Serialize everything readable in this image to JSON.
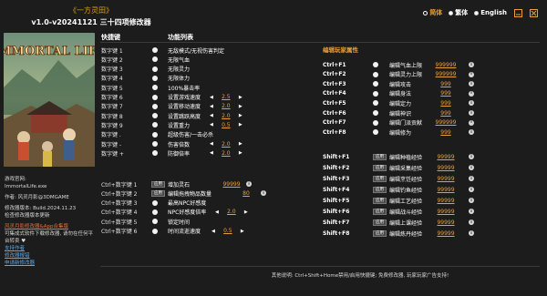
{
  "header": {
    "game_name": "《一方灵田》",
    "app_version": "v1.0-v20241121 三十四项修改器"
  },
  "language": [
    {
      "label": "简体",
      "selected": true
    },
    {
      "label": "繁体",
      "selected": false
    },
    {
      "label": "English",
      "selected": false
    }
  ],
  "colors": {
    "accent": "#e8a038",
    "background": "#1c1c1c",
    "link": "#5aa8e8",
    "title": "#d4a017"
  },
  "cover": {
    "logo_text": "IMMORTAL LIFE"
  },
  "left_info": {
    "site_label": "游戏官网:",
    "site_value": "ImmortalLife.exe",
    "author": "作者: 风灵月影@3DMGAME",
    "version": "修改器版本: Build.2024.11.23",
    "check_update": "检查修改器版本更新",
    "app_promo": "风灵月影修改器&App合集版",
    "app_desc": "可集成式软件下载修改器, 请勿在任何平台转卖 ♥",
    "support": "支持作者",
    "report": "修改器报错",
    "request": "申请新修改器"
  },
  "columns": {
    "hotkey": "快捷键",
    "function": "功能列表"
  },
  "section_edit": "编辑玩家属性",
  "left_rows": [
    {
      "key": "数字键 1",
      "label": "无敌模式/无视伤害判定"
    },
    {
      "key": "数字键 2",
      "label": "无限气血"
    },
    {
      "key": "数字键 3",
      "label": "无限灵力"
    },
    {
      "key": "数字键 4",
      "label": "无限体力"
    },
    {
      "key": "数字键 5",
      "label": "100%暴击率"
    },
    {
      "key": "数字键 6",
      "label": "设置游戏速度",
      "value": "2.5"
    },
    {
      "key": "数字键 7",
      "label": "设置移动速度",
      "value": "2.0"
    },
    {
      "key": "数字键 8",
      "label": "设置跳跃高度",
      "value": "2.0"
    },
    {
      "key": "数字键 9",
      "label": "设置重力",
      "value": "0.5"
    },
    {
      "key": "数字键 .",
      "label": "超级伤害/一击必杀"
    },
    {
      "key": "数字键 -",
      "label": "伤害倍数",
      "value": "2.0"
    },
    {
      "key": "数字键 +",
      "label": "防御倍率",
      "value": "2.0"
    }
  ],
  "left_rows2": [
    {
      "key": "Ctrl+数字键 1",
      "label": "增加灵石",
      "value": "99999",
      "apply": "应用"
    },
    {
      "key": "Ctrl+数字键 2",
      "label": "编辑拖拽物品数量",
      "value": "80",
      "apply": "应用"
    },
    {
      "key": "Ctrl+数字键 3",
      "label": "最高NPC好感度"
    },
    {
      "key": "Ctrl+数字键 4",
      "label": "NPC好感度倍率",
      "value": "2.0"
    },
    {
      "key": "Ctrl+数字键 5",
      "label": "锁定时间"
    },
    {
      "key": "Ctrl+数字键 6",
      "label": "时间流逝速度",
      "value": "0.5"
    }
  ],
  "right_rows": [
    {
      "key": "Ctrl+F1",
      "label": "编辑气血上限",
      "value": "999999"
    },
    {
      "key": "Ctrl+F2",
      "label": "编辑灵力上限",
      "value": "999999"
    },
    {
      "key": "Ctrl+F3",
      "label": "编辑攻击",
      "value": "999"
    },
    {
      "key": "Ctrl+F4",
      "label": "编辑身法",
      "value": "999"
    },
    {
      "key": "Ctrl+F5",
      "label": "编辑定力",
      "value": "999"
    },
    {
      "key": "Ctrl+F6",
      "label": "编辑神识",
      "value": "999"
    },
    {
      "key": "Ctrl+F7",
      "label": "编辑门派贡献",
      "value": "999999"
    },
    {
      "key": "Ctrl+F8",
      "label": "编辑修为",
      "value": "999"
    }
  ],
  "right_rows2": [
    {
      "key": "Shift+F1",
      "label": "编辑种植经验",
      "value": "99999",
      "apply": "应用"
    },
    {
      "key": "Shift+F2",
      "label": "编辑采集经验",
      "value": "99999",
      "apply": "应用"
    },
    {
      "key": "Shift+F3",
      "label": "编辑烹饪经验",
      "value": "99999",
      "apply": "应用"
    },
    {
      "key": "Shift+F4",
      "label": "编辑钓鱼经验",
      "value": "99999",
      "apply": "应用"
    },
    {
      "key": "Shift+F5",
      "label": "编辑工艺经验",
      "value": "99999",
      "apply": "应用"
    },
    {
      "key": "Shift+F6",
      "label": "编辑战斗经验",
      "value": "99999",
      "apply": "应用"
    },
    {
      "key": "Shift+F7",
      "label": "编辑上课经验",
      "value": "99999",
      "apply": "应用"
    },
    {
      "key": "Shift+F8",
      "label": "编辑炼丹经验",
      "value": "99999",
      "apply": "应用"
    }
  ],
  "footer": "其他说明: Ctrl+Shift+Home禁用/启用快捷键; 免费修改器, 玩家玩家广告支持!"
}
